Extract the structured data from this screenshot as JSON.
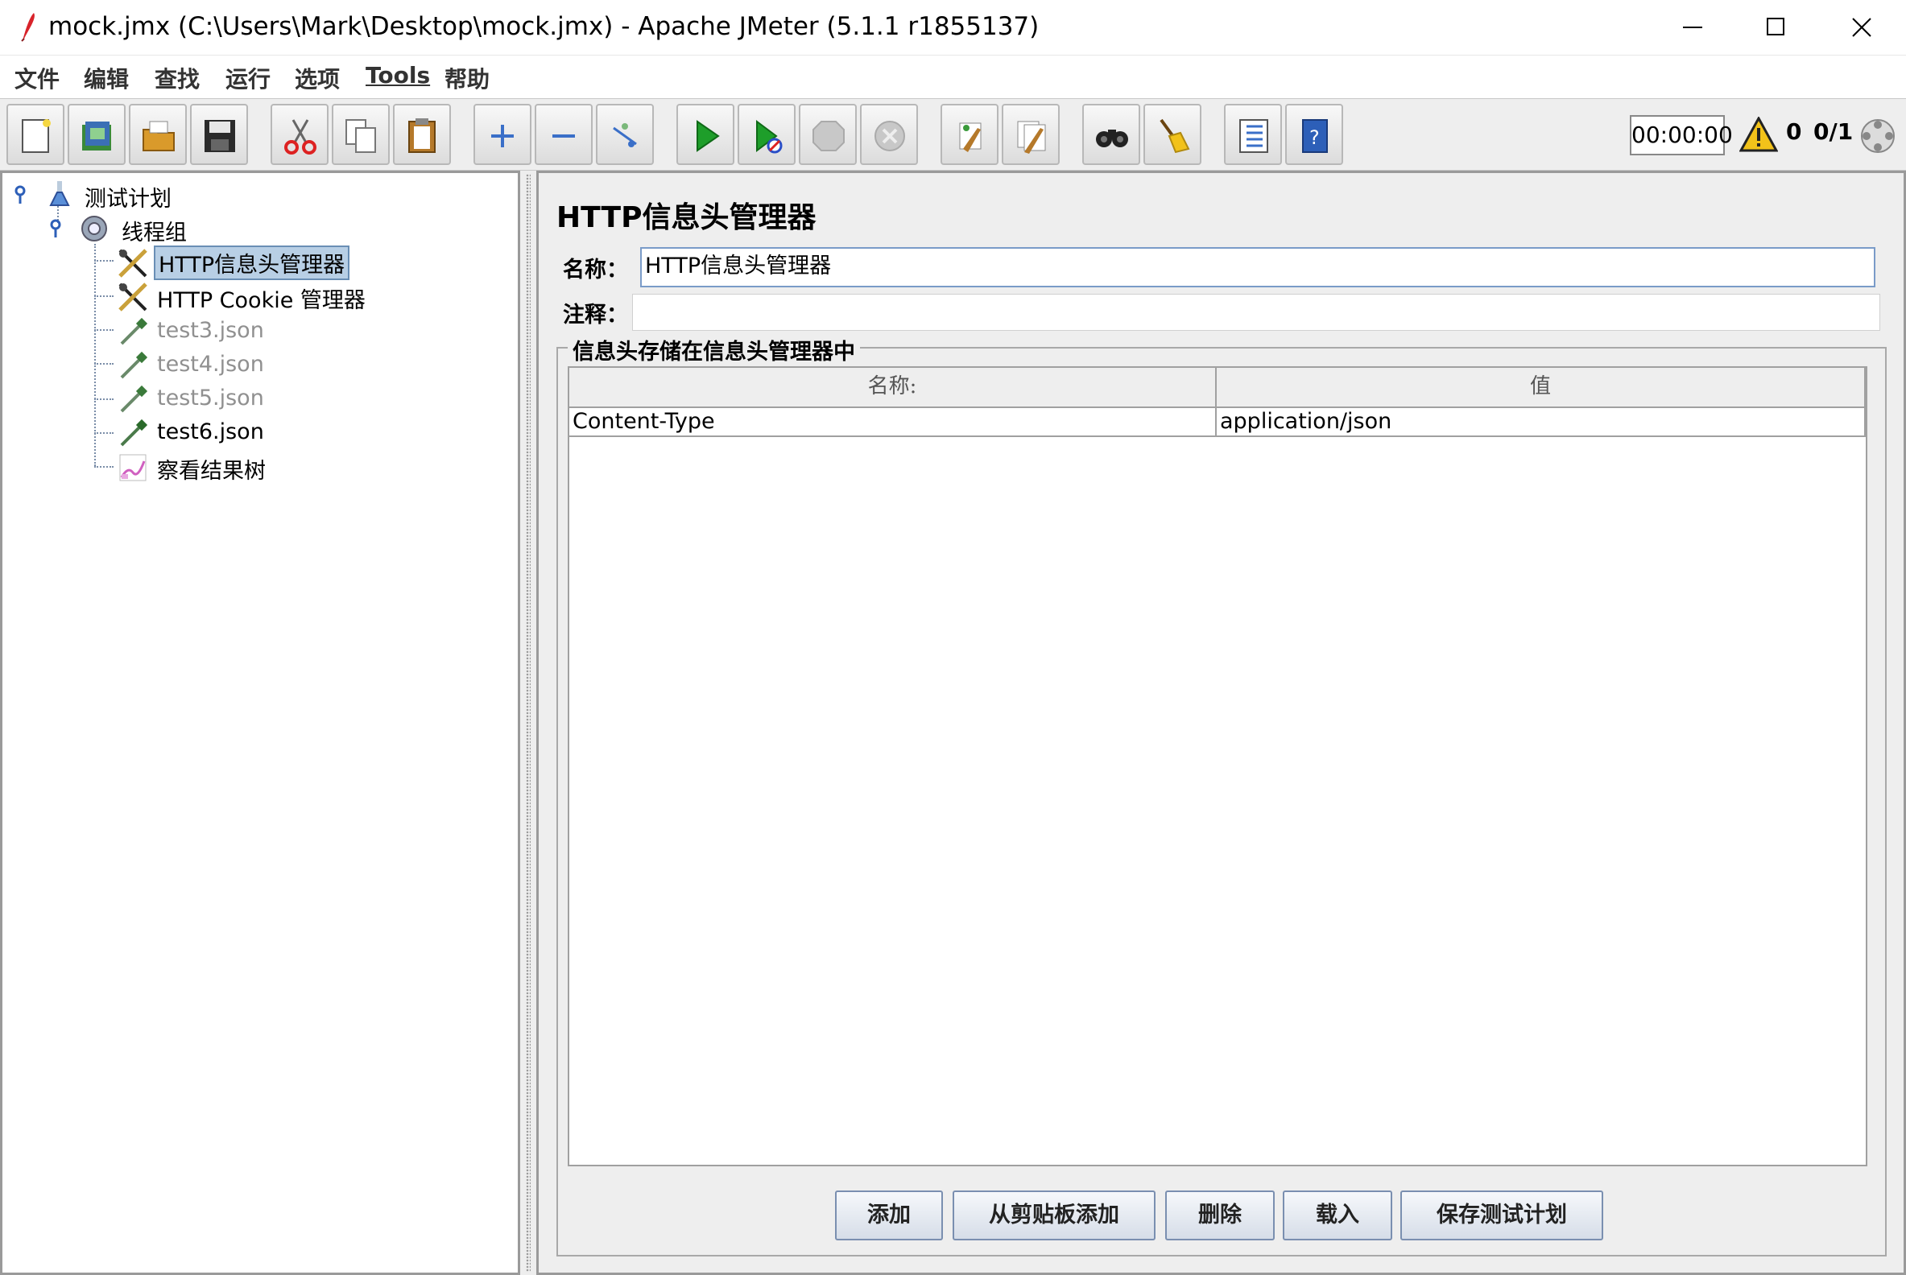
{
  "window": {
    "title": "mock.jmx (C:\\Users\\Mark\\Desktop\\mock.jmx) - Apache JMeter (5.1.1 r1855137)",
    "controls": [
      "minimize-icon",
      "maximize-icon",
      "close-icon"
    ]
  },
  "menubar": {
    "items": [
      "文件",
      "编辑",
      "查找",
      "运行",
      "选项",
      "Tools",
      "帮助"
    ]
  },
  "toolbar": {
    "buttons": [
      "new-icon",
      "templates-icon",
      "open-icon",
      "save-icon",
      "cut-icon",
      "copy-icon",
      "paste-icon",
      "expand-all-icon",
      "collapse-all-icon",
      "toggle-icon",
      "start-icon",
      "start-no-pause-icon",
      "stop-icon",
      "shutdown-icon",
      "clear-icon",
      "clear-all-icon",
      "search-icon",
      "reset-search-icon",
      "function-helper-icon",
      "help-icon"
    ],
    "timer": "00:00:00",
    "warning_count": "0",
    "thread_count": "0/1"
  },
  "tree": {
    "nodes": [
      {
        "label": "测试计划",
        "icon": "test-plan-icon",
        "state": "normal"
      },
      {
        "label": "线程组",
        "icon": "thread-group-icon",
        "state": "normal"
      },
      {
        "label": "HTTP信息头管理器",
        "icon": "config-tool-icon",
        "state": "selected"
      },
      {
        "label": "HTTP Cookie 管理器",
        "icon": "config-tool-icon",
        "state": "normal"
      },
      {
        "label": "test3.json",
        "icon": "sampler-pipette-icon",
        "state": "disabled"
      },
      {
        "label": "test4.json",
        "icon": "sampler-pipette-icon",
        "state": "disabled"
      },
      {
        "label": "test5.json",
        "icon": "sampler-pipette-icon",
        "state": "disabled"
      },
      {
        "label": "test6.json",
        "icon": "sampler-pipette-icon",
        "state": "normal"
      },
      {
        "label": "察看结果树",
        "icon": "listener-graph-icon",
        "state": "normal"
      }
    ]
  },
  "panel": {
    "title": "HTTP信息头管理器",
    "name_label": "名称：",
    "name_value": "HTTP信息头管理器",
    "comment_label": "注释：",
    "comment_value": "",
    "group_title": "信息头存储在信息头管理器中",
    "table": {
      "columns": [
        "名称:",
        "值"
      ],
      "rows": [
        [
          "Content-Type",
          "application/json"
        ]
      ]
    },
    "buttons": [
      "添加",
      "从剪贴板添加",
      "删除",
      "载入",
      "保存测试计划"
    ]
  },
  "colors": {
    "selection_bg": "#b8cfe5",
    "panel_bg": "#eeeeee",
    "start_green": "#1e9e2a"
  }
}
